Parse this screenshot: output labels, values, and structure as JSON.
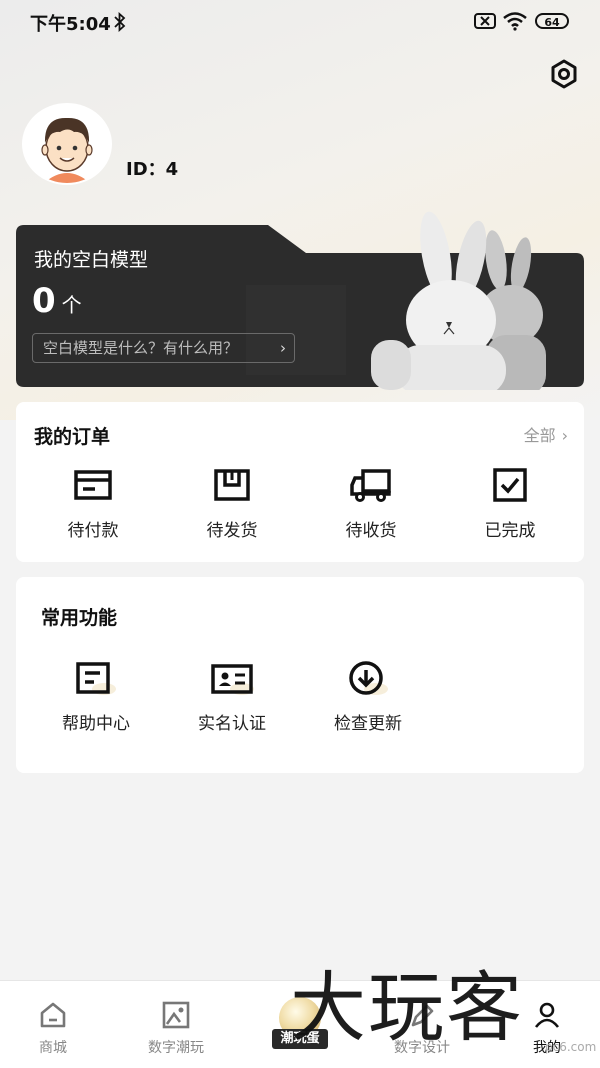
{
  "status_bar": {
    "time": "下午5:04",
    "battery": "64"
  },
  "profile": {
    "id_text": "ID：4"
  },
  "blank_model": {
    "title": "我的空白模型",
    "count": "0",
    "unit": "个",
    "link_text": "空白模型是什么？有什么用？",
    "link_chevron": "›"
  },
  "orders": {
    "title": "我的订单",
    "all_label": "全部",
    "all_chevron": "›",
    "items": [
      {
        "label": "待付款",
        "icon": "wallet-icon"
      },
      {
        "label": "待发货",
        "icon": "package-icon"
      },
      {
        "label": "待收货",
        "icon": "truck-icon"
      },
      {
        "label": "已完成",
        "icon": "check-box-icon"
      }
    ]
  },
  "functions": {
    "title": "常用功能",
    "items": [
      {
        "label": "帮助中心",
        "icon": "help-doc-icon"
      },
      {
        "label": "实名认证",
        "icon": "id-card-icon"
      },
      {
        "label": "检查更新",
        "icon": "download-circle-icon"
      }
    ]
  },
  "bottom_nav": {
    "items": [
      {
        "label": "商城",
        "icon": "home-icon"
      },
      {
        "label": "数字潮玩",
        "icon": "image-icon"
      },
      {
        "label": "潮玩蛋",
        "icon": "egg-icon"
      },
      {
        "label": "数字设计",
        "icon": "pen-icon"
      },
      {
        "label": "我的",
        "icon": "user-icon"
      }
    ]
  },
  "watermark": {
    "text": "大玩客",
    "small": "pc6.com"
  }
}
